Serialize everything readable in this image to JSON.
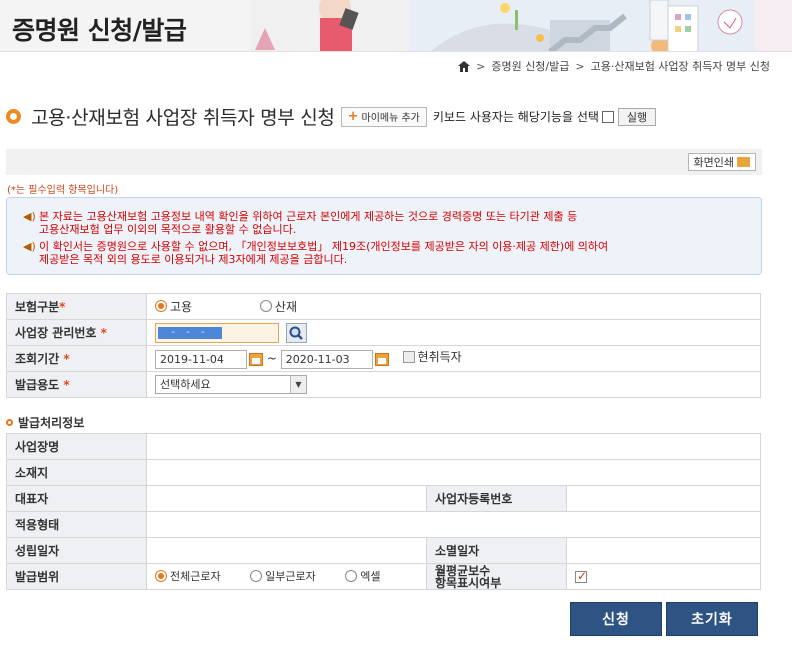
{
  "header": {
    "title": "증명원 신청/발급"
  },
  "breadcrumb": {
    "items": [
      "증명원 신청/발급",
      "고용·산재보험 사업장 취득자 명부 신청"
    ]
  },
  "page": {
    "title": "고용·산재보험 사업장 취득자 명부 신청",
    "mymenu_label": "마이메뉴 추가",
    "keyboard_text": "키보드 사용자는 해당기능을 선택",
    "run_label": "실행",
    "print_label": "화면인쇄",
    "required_note": "(*는 필수입력 항목입니다)"
  },
  "notice": {
    "line1a": "본 자료는 고용산재보험 고용정보 내역 확인을 위하여 근로자 본인에게 제공하는 것으로 경력증명 또는 타기관 제출 등",
    "line1b": "고용산재보험 업무 이외의 목적으로 활용할 수 없습니다.",
    "line2a": "이 확인서는 증명원으로 사용할 수 없으며, 「개인정보보호법」 제19조(개인정보를 제공받은 자의 이용·제공 제한)에 의하여",
    "line2b": "제공받은 목적 외의 용도로 이용되거나 제3자에게 제공을 금합니다."
  },
  "form": {
    "insurance_label": "보험구분",
    "insurance_options": [
      "고용",
      "산재"
    ],
    "insurance_selected": "고용",
    "biz_no_label": "사업장 관리번호",
    "biz_no_value": "- - -",
    "period_label": "조회기간",
    "date_from": "2019-11-04",
    "date_sep": "~",
    "date_to": "2020-11-03",
    "current_only_label": "현취득자",
    "purpose_label": "발급용도",
    "purpose_value": "선택하세요",
    "required_mark": "*"
  },
  "issue_info": {
    "section_title": "발급처리정보",
    "biz_name_label": "사업장명",
    "address_label": "소재지",
    "ceo_label": "대표자",
    "reg_no_label": "사업자등록번호",
    "apply_type_label": "적용형태",
    "est_date_label": "성립일자",
    "close_date_label": "소멸일자",
    "scope_label": "발급범위",
    "scope_options": [
      "전체근로자",
      "일부근로자",
      "엑셀"
    ],
    "scope_selected": "전체근로자",
    "wage_label_1": "월평균보수",
    "wage_label_2": "항목표시여부"
  },
  "actions": {
    "apply_label": "신청",
    "reset_label": "초기화"
  },
  "colors": {
    "accent": "#e8791a",
    "primary_button": "#2d5483",
    "notice_text": "#d40000"
  }
}
